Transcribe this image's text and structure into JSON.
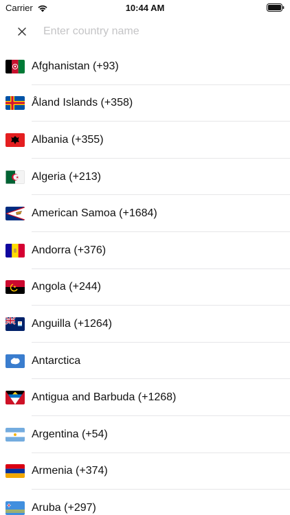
{
  "status": {
    "carrier": "Carrier",
    "time": "10:44 AM"
  },
  "search": {
    "placeholder": "Enter country name",
    "value": ""
  },
  "countries": [
    {
      "label": "Afghanistan (+93)",
      "flag": "af-flag-icon"
    },
    {
      "label": "Åland Islands (+358)",
      "flag": "ax-flag-icon"
    },
    {
      "label": "Albania (+355)",
      "flag": "al-flag-icon"
    },
    {
      "label": "Algeria (+213)",
      "flag": "dz-flag-icon"
    },
    {
      "label": "American Samoa (+1684)",
      "flag": "as-flag-icon"
    },
    {
      "label": "Andorra (+376)",
      "flag": "ad-flag-icon"
    },
    {
      "label": "Angola (+244)",
      "flag": "ao-flag-icon"
    },
    {
      "label": "Anguilla (+1264)",
      "flag": "ai-flag-icon"
    },
    {
      "label": "Antarctica",
      "flag": "aq-flag-icon"
    },
    {
      "label": "Antigua and Barbuda (+1268)",
      "flag": "ag-flag-icon"
    },
    {
      "label": "Argentina (+54)",
      "flag": "ar-flag-icon"
    },
    {
      "label": "Armenia (+374)",
      "flag": "am-flag-icon"
    },
    {
      "label": "Aruba (+297)",
      "flag": "aw-flag-icon"
    }
  ]
}
